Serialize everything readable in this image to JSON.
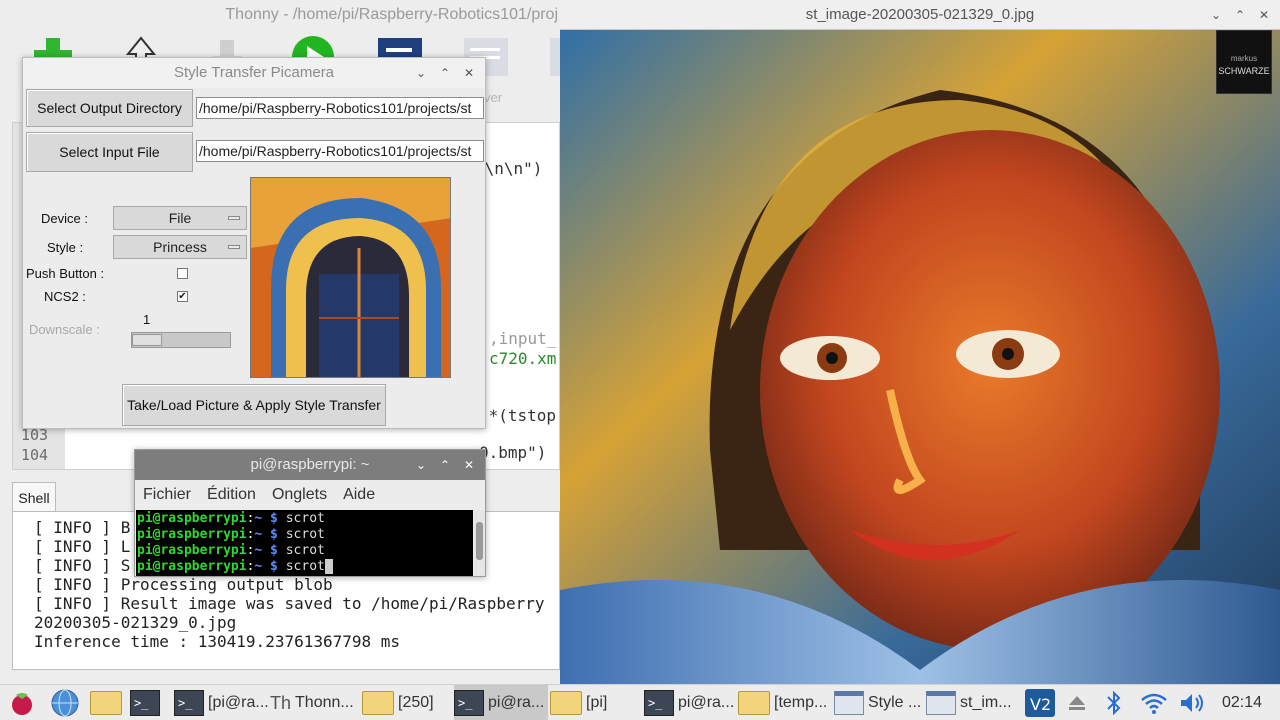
{
  "thonny": {
    "title": "Thonny  -  /home/pi/Raspberry-Robotics101/proj",
    "toolbar_partial_label": "ver",
    "editor": {
      "line_numbers": [
        "103",
        "104"
      ],
      "lines": [
        " \\n\\n\")",
        ",input_",
        "c720.xm",
        ")*(tstop",
        "0.bmp\")"
      ]
    },
    "shell_tab": "Shell",
    "shell_lines": [
      "[ INFO ] B",
      "[ INFO ] L",
      "[ INFO ] S",
      "[ INFO ] Processing output blob",
      "[ INFO ] Result image was saved to /home/pi/Raspberry",
      "20200305-021329_0.jpg",
      "Inference time : 130419.23761367798 ms"
    ]
  },
  "viewer": {
    "title": "st_image-20200305-021329_0.jpg",
    "watermark_line1": "markus",
    "watermark_line2": "SCHWARZE"
  },
  "dialog": {
    "title": "Style Transfer Picamera",
    "select_output_label": "Select Output Directory",
    "output_path": "/home/pi/Raspberry-Robotics101/projects/st",
    "select_input_label": "Select Input File",
    "input_path": "/home/pi/Raspberry-Robotics101/projects/st",
    "device_label": "Device :",
    "device_value": "File",
    "style_label": "Style :",
    "style_value": "Princess",
    "push_button_label": "Push Button :",
    "push_button_checked": false,
    "ncs2_label": "NCS2 :",
    "ncs2_checked": true,
    "ncs2_mark": "✔",
    "downscale_label": "Downscale :",
    "downscale_value": "1",
    "apply_label": "Take/Load Picture & Apply Style Transfer"
  },
  "terminal": {
    "title": "pi@raspberrypi: ~",
    "menu": [
      "Fichier",
      "Édition",
      "Onglets",
      "Aide"
    ],
    "prompt_user": "pi@raspberrypi",
    "prompt_colon": ":",
    "prompt_path": "~ $",
    "commands": [
      " scrot",
      " scrot",
      " scrot",
      " scrot"
    ]
  },
  "taskbar": {
    "items": [
      "[pi@ra...",
      "Thonn...",
      "[250]",
      "pi@ra...",
      "[pi]",
      "pi@ra...",
      "[temp...",
      "Style ...",
      "st_im..."
    ],
    "clock": "02:14"
  }
}
